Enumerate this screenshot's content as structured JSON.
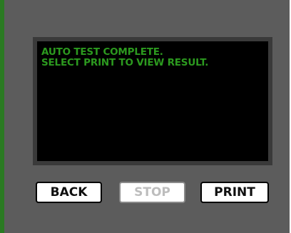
{
  "screen": {
    "lines": [
      "AUTO TEST COMPLETE.",
      "SELECT PRINT TO VIEW RESULT."
    ]
  },
  "buttons": {
    "back": "BACK",
    "stop": "STOP",
    "print": "PRINT"
  },
  "colors": {
    "text_green": "#2c9a1f",
    "bezel": "#5c5c5c",
    "accent_edge": "#2a7a22"
  }
}
